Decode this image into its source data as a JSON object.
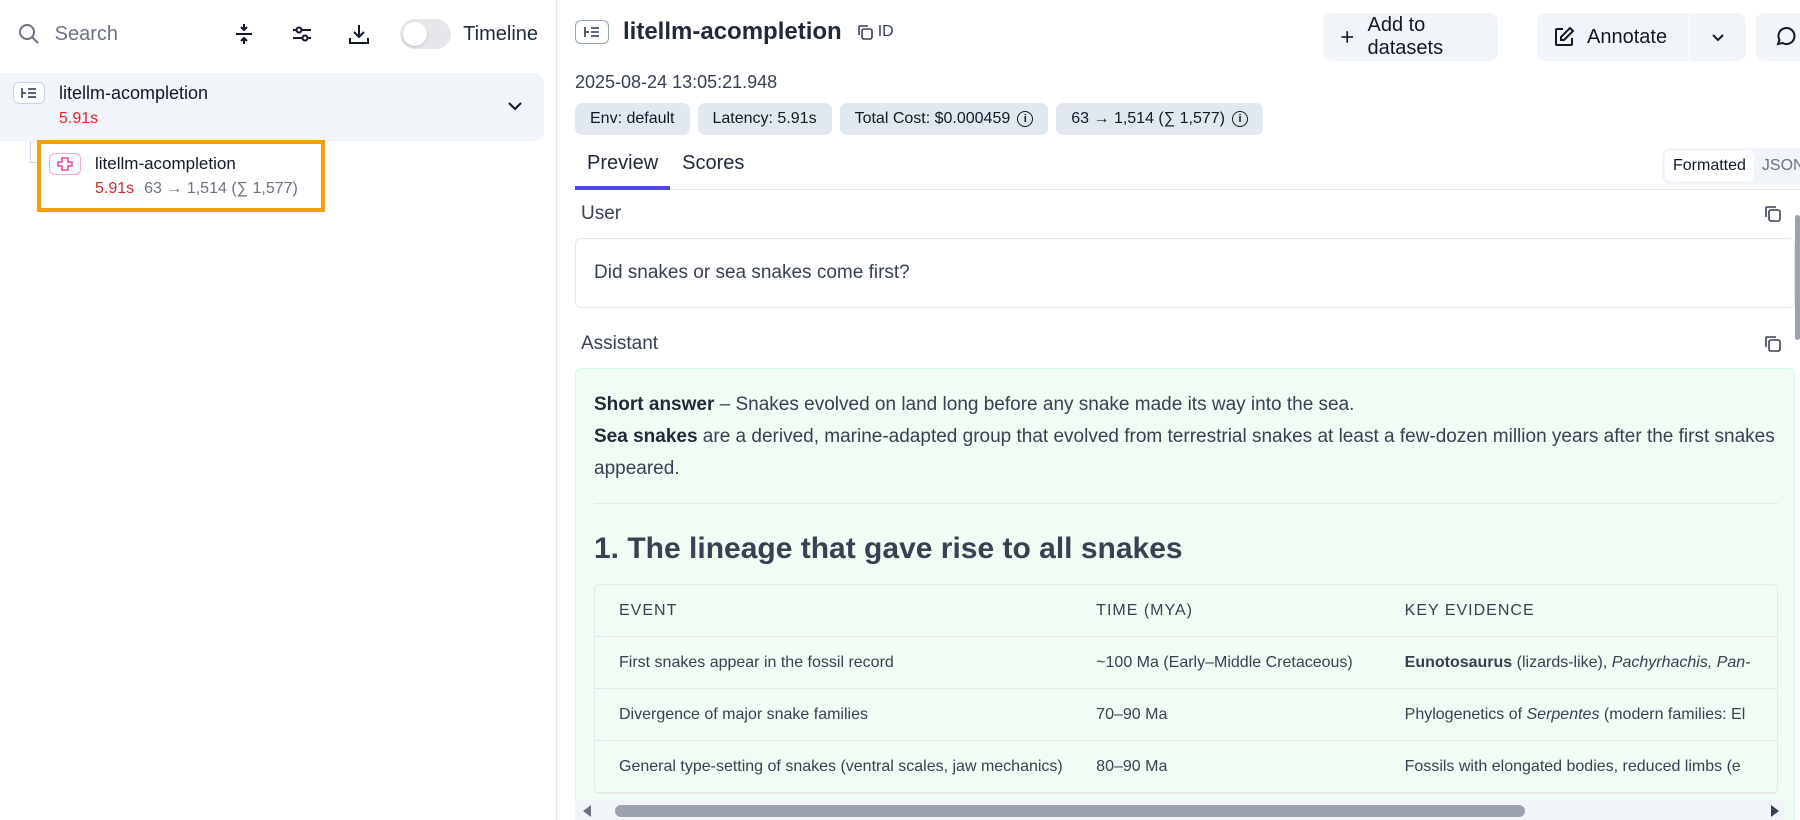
{
  "left": {
    "search_placeholder": "Search",
    "timeline_label": "Timeline",
    "root_node": {
      "title": "litellm-acompletion",
      "latency": "5.91s"
    },
    "child_node": {
      "title": "litellm-acompletion",
      "latency": "5.91s",
      "tokens": "63 → 1,514 (∑ 1,577)"
    }
  },
  "header": {
    "title": "litellm-acompletion",
    "id_label": "ID",
    "add_to_datasets": "Add to datasets",
    "annotate": "Annotate",
    "timestamp": "2025-08-24 13:05:21.948"
  },
  "badges": {
    "env": "Env: default",
    "latency": "Latency: 5.91s",
    "cost": "Total Cost: $0.000459",
    "tokens": "63 → 1,514 (∑ 1,577)"
  },
  "tabs": {
    "preview": "Preview",
    "scores": "Scores"
  },
  "view_toggle": {
    "formatted": "Formatted",
    "json": "JSON"
  },
  "user": {
    "label": "User",
    "message": "Did snakes or sea snakes come first?"
  },
  "assistant": {
    "label": "Assistant",
    "short_answer_bold": "Short answer",
    "short_answer_text": " – Snakes evolved on land long before any snake made its way into the sea.",
    "sea_snakes_bold": "Sea snakes",
    "sea_snakes_text": " are a derived, marine-adapted group that evolved from terrestrial snakes at least a few-dozen million years after the first snakes appeared.",
    "heading": "1. The lineage that gave rise to all snakes",
    "table": {
      "headers": [
        "EVENT",
        "TIME (MYA)",
        "KEY EVIDENCE"
      ],
      "rows": [
        {
          "event": "First snakes appear in the fossil record",
          "time": "~100 Ma (Early–Middle Cretaceous)",
          "evidence_bold": "Eunotosaurus",
          "evidence_text": " (lizards-like), ",
          "evidence_italic": "Pachyrhachis, Pan-"
        },
        {
          "event": "Divergence of major snake families",
          "time": "70–90 Ma",
          "evidence_pre": "Phylogenetics of ",
          "evidence_italic": "Serpentes",
          "evidence_text": " (modern families: El"
        },
        {
          "event": "General type-setting of snakes (ventral scales, jaw mechanics)",
          "time": "80–90 Ma",
          "evidence_text": "Fossils with elongated bodies, reduced limbs (e"
        }
      ]
    }
  }
}
